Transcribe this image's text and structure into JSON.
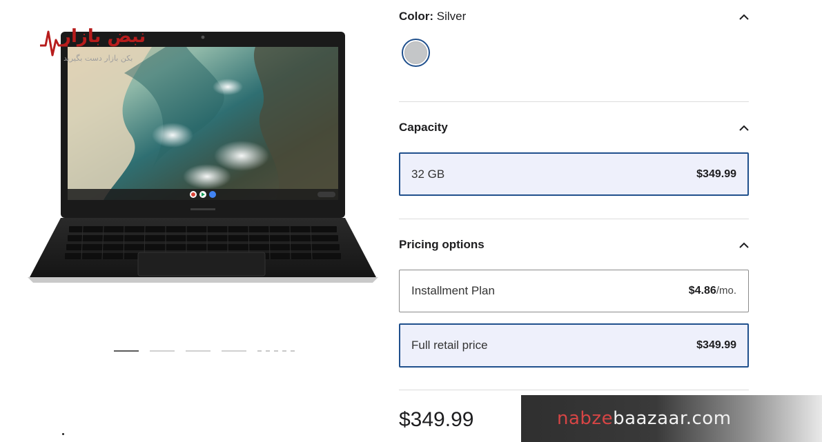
{
  "watermark": {
    "fa_title": "نبض بازار",
    "fa_sub": "بکن بازار دست بگیرید",
    "site_part1": "nabze",
    "site_part2": "baazaar.com"
  },
  "gallery": {
    "laptop_brand": "SAMSUNG",
    "image_count": 5,
    "active_index": 0
  },
  "color": {
    "label": "Color:",
    "value": "Silver",
    "swatches": [
      {
        "name": "Silver",
        "hex": "#c4c6c8",
        "selected": true
      }
    ]
  },
  "capacity": {
    "title": "Capacity",
    "options": [
      {
        "label": "32 GB",
        "price": "$349.99",
        "selected": true
      }
    ]
  },
  "pricing": {
    "title": "Pricing options",
    "installment": {
      "label": "Installment Plan",
      "price": "$4.86",
      "unit": "/mo."
    },
    "full": {
      "label": "Full retail price",
      "price": "$349.99"
    }
  },
  "total": {
    "price": "$349.99"
  },
  "colors": {
    "accent": "#1f4f8c",
    "selected_bg": "#eef0fb",
    "border": "#8a8a8a",
    "divider": "#dcdcdc"
  }
}
